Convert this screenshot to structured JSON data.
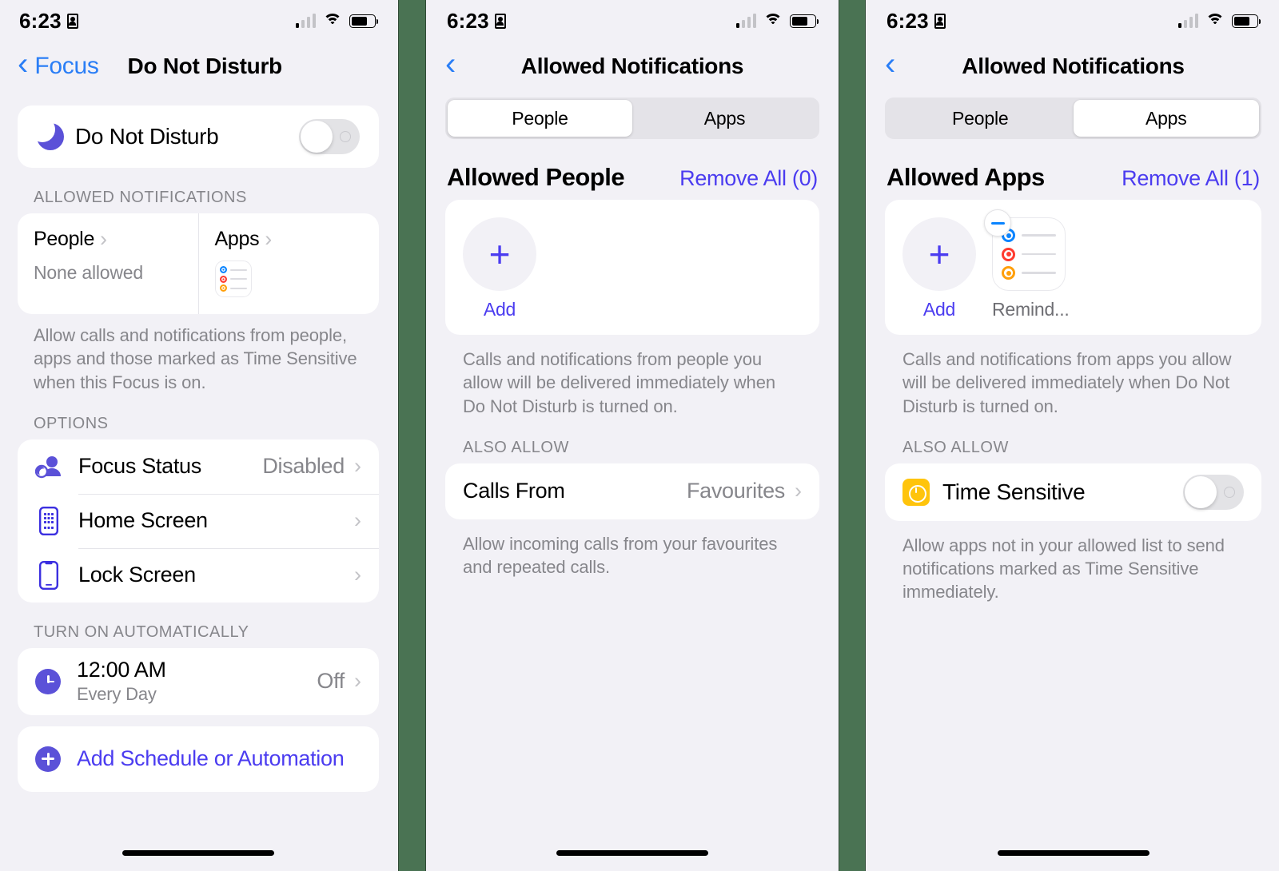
{
  "status_bar": {
    "time": "6:23",
    "recording_icon": "record-indicator-icon",
    "signal_icon": "cellular-signal-icon",
    "wifi_icon": "wifi-icon",
    "battery_icon": "battery-icon"
  },
  "panel1": {
    "nav": {
      "back_label": "Focus",
      "title": "Do Not Disturb",
      "back_icon": "chevron-left-icon"
    },
    "dnd_toggle": {
      "label": "Do Not Disturb",
      "icon": "moon-icon",
      "state": "off"
    },
    "allowed_notifications": {
      "header": "ALLOWED NOTIFICATIONS",
      "people": {
        "title": "People",
        "subtitle": "None allowed"
      },
      "apps": {
        "title": "Apps",
        "icon": "reminders-app-icon"
      },
      "footnote": "Allow calls and notifications from people, apps and those marked as Time Sensitive when this Focus is on."
    },
    "options": {
      "header": "OPTIONS",
      "rows": [
        {
          "label": "Focus Status",
          "value": "Disabled",
          "icon": "focus-status-icon"
        },
        {
          "label": "Home Screen",
          "value": "",
          "icon": "home-screen-icon"
        },
        {
          "label": "Lock Screen",
          "value": "",
          "icon": "lock-screen-icon"
        }
      ]
    },
    "turn_on_automatically": {
      "header": "TURN ON AUTOMATICALLY",
      "schedule": {
        "time": "12:00 AM",
        "repeat": "Every Day",
        "state": "Off",
        "icon": "clock-icon"
      },
      "add_schedule": {
        "label": "Add Schedule or Automation",
        "icon": "plus-circle-icon"
      }
    }
  },
  "panel2": {
    "nav": {
      "title": "Allowed Notifications",
      "back_icon": "chevron-left-icon"
    },
    "segmented": {
      "options": [
        "People",
        "Apps"
      ],
      "selected": "People"
    },
    "list_title": "Allowed People",
    "remove_all": "Remove All (0)",
    "tiles": [
      {
        "label": "Add",
        "type": "add",
        "icon": "plus-icon"
      }
    ],
    "footnote": "Calls and notifications from people you allow will be delivered immediately when Do Not Disturb is turned on.",
    "also_allow": {
      "header": "ALSO ALLOW",
      "calls_from": {
        "label": "Calls From",
        "value": "Favourites"
      },
      "footnote": "Allow incoming calls from your favourites and repeated calls."
    }
  },
  "panel3": {
    "nav": {
      "title": "Allowed Notifications",
      "back_icon": "chevron-left-icon"
    },
    "segmented": {
      "options": [
        "People",
        "Apps"
      ],
      "selected": "Apps"
    },
    "list_title": "Allowed Apps",
    "remove_all": "Remove All (1)",
    "tiles": [
      {
        "label": "Add",
        "type": "add",
        "icon": "plus-icon"
      },
      {
        "label": "Remind...",
        "type": "app",
        "icon": "reminders-app-icon",
        "badge": "minus-badge-icon"
      }
    ],
    "footnote": "Calls and notifications from apps you allow will be delivered immediately when Do Not Disturb is turned on.",
    "also_allow": {
      "header": "ALSO ALLOW",
      "time_sensitive": {
        "label": "Time Sensitive",
        "icon": "time-sensitive-icon",
        "state": "off"
      },
      "footnote": "Allow apps not in your allowed list to send notifications marked as Time Sensitive immediately."
    }
  },
  "colors": {
    "accent_blue": "#2a7ef6",
    "tint_purple": "#4b3cf0",
    "icon_purple": "#5b51d8",
    "background": "#f2f1f6",
    "divider_green": "#4a7353",
    "time_sensitive_yellow": "#ffc40c"
  }
}
